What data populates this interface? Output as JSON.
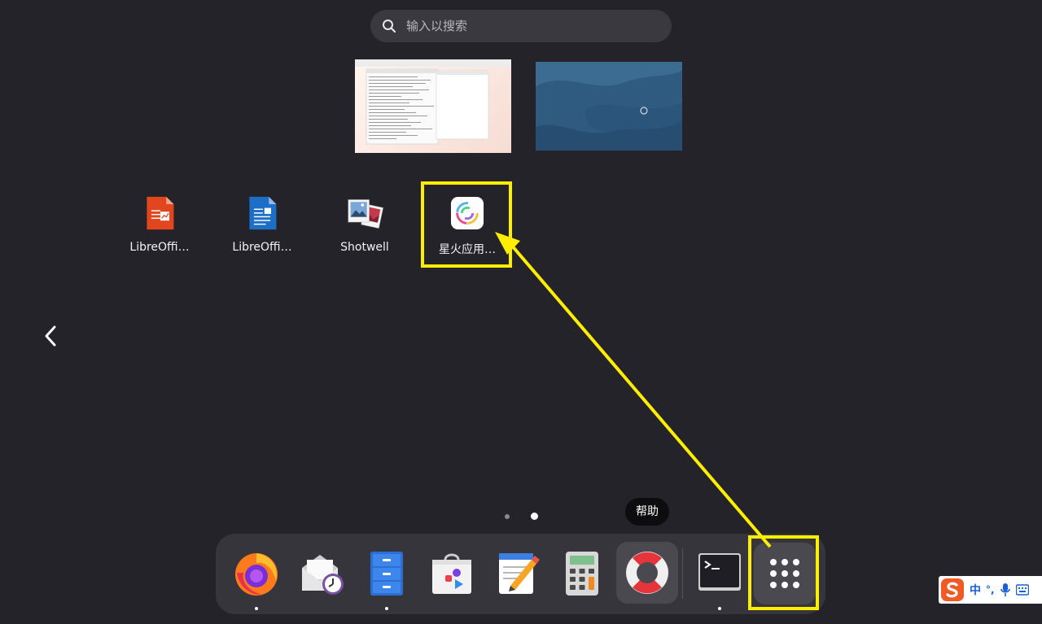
{
  "search": {
    "placeholder": "输入以搜索"
  },
  "workspaces": [
    {
      "name": "workspace-1"
    },
    {
      "name": "workspace-2"
    }
  ],
  "apps": [
    {
      "label": "LibreOffi…",
      "icon": "libreoffice-impress-icon"
    },
    {
      "label": "LibreOffi…",
      "icon": "libreoffice-writer-icon"
    },
    {
      "label": "Shotwell",
      "icon": "shotwell-icon"
    },
    {
      "label": "星火应用…",
      "icon": "spark-store-icon"
    }
  ],
  "pager": {
    "pages": 2,
    "current_page": 2
  },
  "tooltip": {
    "text": "帮助"
  },
  "dock": {
    "items": [
      {
        "name": "firefox",
        "icon": "firefox-icon",
        "running": true
      },
      {
        "name": "evolution-mail",
        "icon": "mail-clock-icon",
        "running": false
      },
      {
        "name": "files",
        "icon": "file-cabinet-icon",
        "running": true
      },
      {
        "name": "software",
        "icon": "software-store-icon",
        "running": false
      },
      {
        "name": "text-editor",
        "icon": "text-editor-icon",
        "running": false
      },
      {
        "name": "calculator",
        "icon": "calculator-icon",
        "running": false
      },
      {
        "name": "help",
        "icon": "lifebuoy-icon",
        "running": false
      },
      {
        "name": "terminal",
        "icon": "terminal-icon",
        "running": true
      },
      {
        "name": "show-apps",
        "icon": "app-grid-icon",
        "running": false
      }
    ]
  },
  "ime": {
    "mode": "中",
    "punct": "°,"
  },
  "colors": {
    "background": "#242329",
    "highlight": "#ffee00",
    "dock": "#36353b"
  }
}
